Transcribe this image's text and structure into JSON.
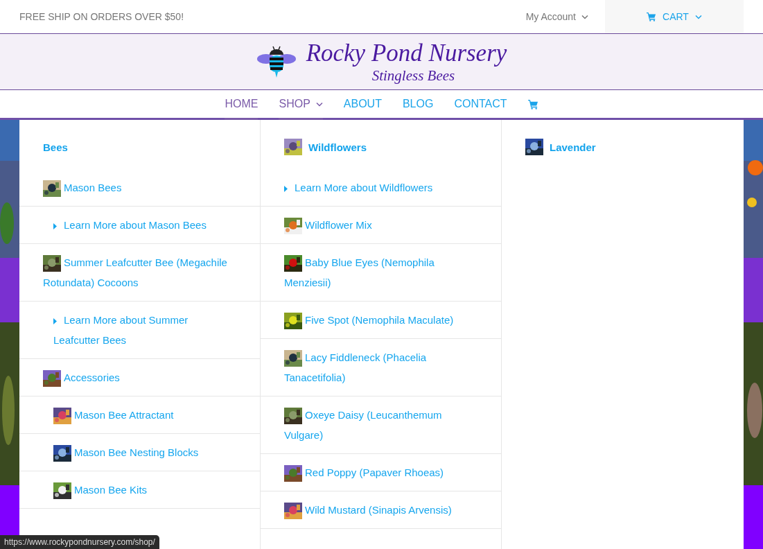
{
  "top_bar": {
    "promo": "FREE SHIP ON ORDERS OVER $50!",
    "account": "My Account",
    "cart": "CART"
  },
  "header": {
    "title": "Rocky Pond Nursery",
    "subtitle": "Stingless Bees"
  },
  "nav": [
    {
      "label": "HOME",
      "kind": "link",
      "selected": true
    },
    {
      "label": "SHOP",
      "kind": "dropdown",
      "selected": true
    },
    {
      "label": "ABOUT",
      "kind": "link",
      "selected": false
    },
    {
      "label": "BLOG",
      "kind": "link",
      "selected": false
    },
    {
      "label": "CONTACT",
      "kind": "link",
      "selected": false
    },
    {
      "kind": "cart_icon"
    }
  ],
  "mega_menu": {
    "columns": [
      {
        "heading": {
          "text": "Bees",
          "kind": "plain"
        },
        "items": [
          {
            "label": "Mason Bees",
            "kind": "product",
            "children": [
              {
                "label": "Learn More about Mason Bees",
                "kind": "learn_more"
              }
            ]
          },
          {
            "label": "Summer Leafcutter Bee (Megachile Rotundata) Cocoons",
            "kind": "product",
            "children": [
              {
                "label": "Learn More about Summer Leafcutter Bees",
                "kind": "learn_more"
              }
            ]
          },
          {
            "label": "Accessories",
            "kind": "product",
            "children": [
              {
                "label": "Mason Bee Attractant",
                "kind": "product"
              },
              {
                "label": "Mason Bee Nesting Blocks",
                "kind": "product"
              },
              {
                "label": "Mason Bee Kits",
                "kind": "product"
              }
            ]
          }
        ]
      },
      {
        "heading": {
          "text": "Wildflowers",
          "kind": "thumbnail"
        },
        "items": [
          {
            "label": "Learn More about Wildflowers",
            "kind": "learn_more"
          },
          {
            "label": "Wildflower Mix",
            "kind": "product"
          },
          {
            "label": "Baby Blue Eyes (Nemophila Menziesii)",
            "kind": "product"
          },
          {
            "label": "Five Spot (Nemophila Maculate)",
            "kind": "product"
          },
          {
            "label": "Lacy Fiddleneck (Phacelia Tanacetifolia)",
            "kind": "product"
          },
          {
            "label": "Oxeye Daisy (Leucanthemum Vulgare)",
            "kind": "product"
          },
          {
            "label": "Red Poppy (Papaver Rhoeas)",
            "kind": "product"
          },
          {
            "label": "Wild Mustard (Sinapis Arvensis)",
            "kind": "product"
          }
        ]
      },
      {
        "heading": {
          "text": "Lavender",
          "kind": "thumbnail"
        }
      }
    ]
  },
  "status_bar": {
    "url": "https://www.rockypondnursery.com/shop/"
  }
}
